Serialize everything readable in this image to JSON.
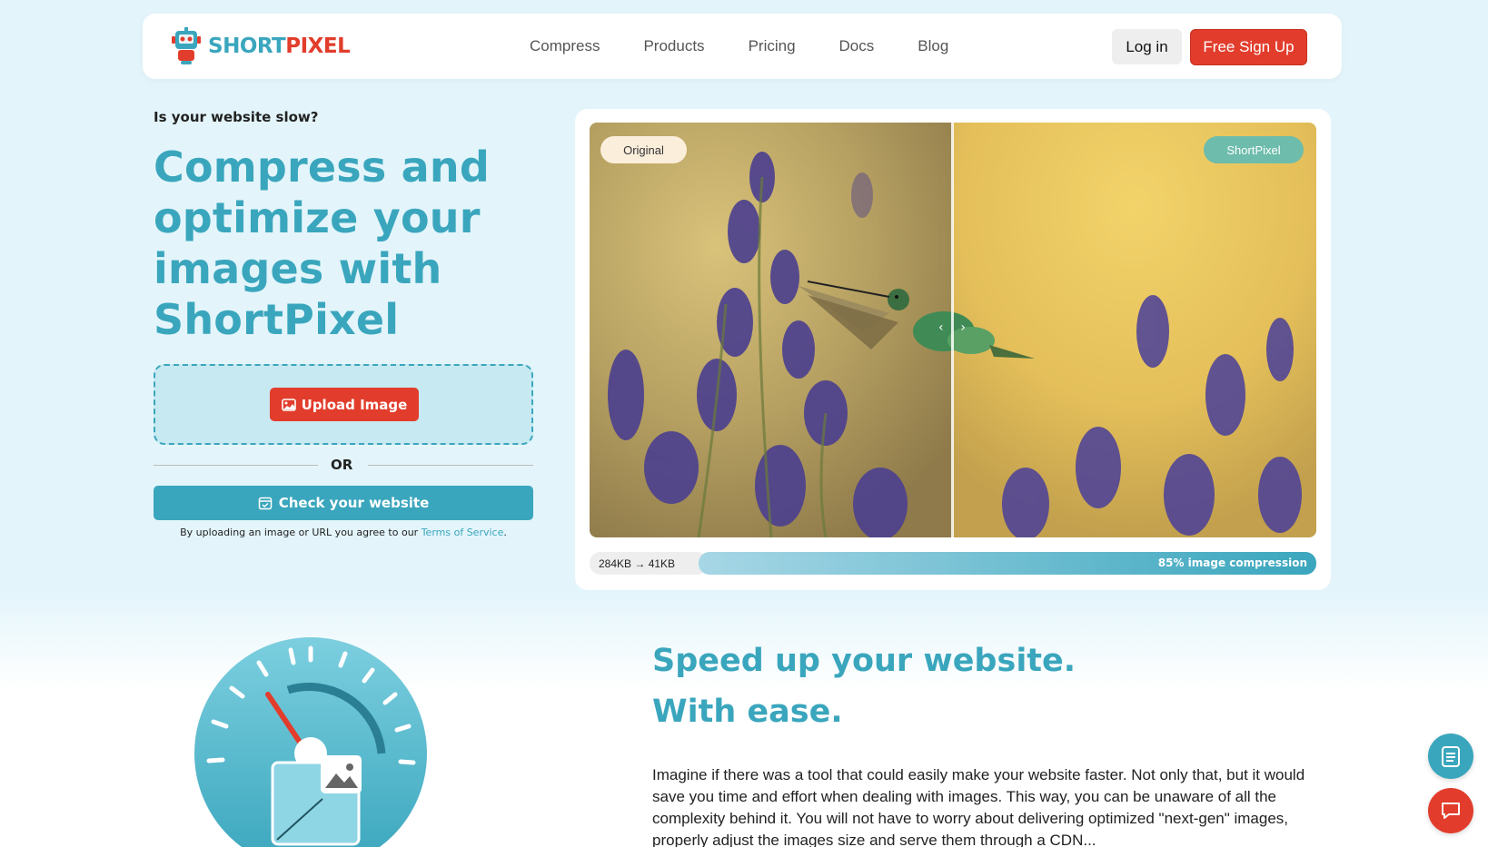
{
  "header": {
    "logo": {
      "short": "SHORT",
      "pixel": "PIXEL",
      "icon": "robot-logo-icon"
    },
    "nav": [
      "Compress",
      "Products",
      "Pricing",
      "Docs",
      "Blog"
    ],
    "login_label": "Log in",
    "signup_label": "Free Sign Up"
  },
  "hero": {
    "eyebrow": "Is your website slow?",
    "title_lines": [
      "Compress and",
      "optimize your",
      "images with",
      "ShortPixel"
    ],
    "upload_label": "Upload Image",
    "upload_icon": "image-icon",
    "or_label": "OR",
    "check_label": "Check your website",
    "check_icon": "calendar-check-icon",
    "tos_prefix": "By uploading an image or URL you agree to our ",
    "tos_link": "Terms of Service",
    "tos_suffix": "."
  },
  "compare": {
    "original_label": "Original",
    "shortpixel_label": "ShortPixel",
    "size_text": "284KB → 41KB",
    "compression_text": "85% image compression",
    "compression_fraction": 0.85,
    "handle_left": "‹",
    "handle_right": "›"
  },
  "speed": {
    "title_line1": "Speed up your website.",
    "title_line2": "With ease.",
    "body": "Imagine if there was a tool that could easily make your website faster. Not only that, but it would save you time and effort when dealing with images. This way, you can be unaware of all the complexity behind it. You will not have to worry about delivering optimized \"next-gen\" images, properly adjust the images size and serve them through a CDN..."
  },
  "floating": {
    "first_icon": "checklist-icon",
    "second_icon": "chat-icon"
  },
  "colors": {
    "brand_teal": "#3aa6bd",
    "brand_red": "#e23d2c",
    "background": "#e3f5fb"
  }
}
